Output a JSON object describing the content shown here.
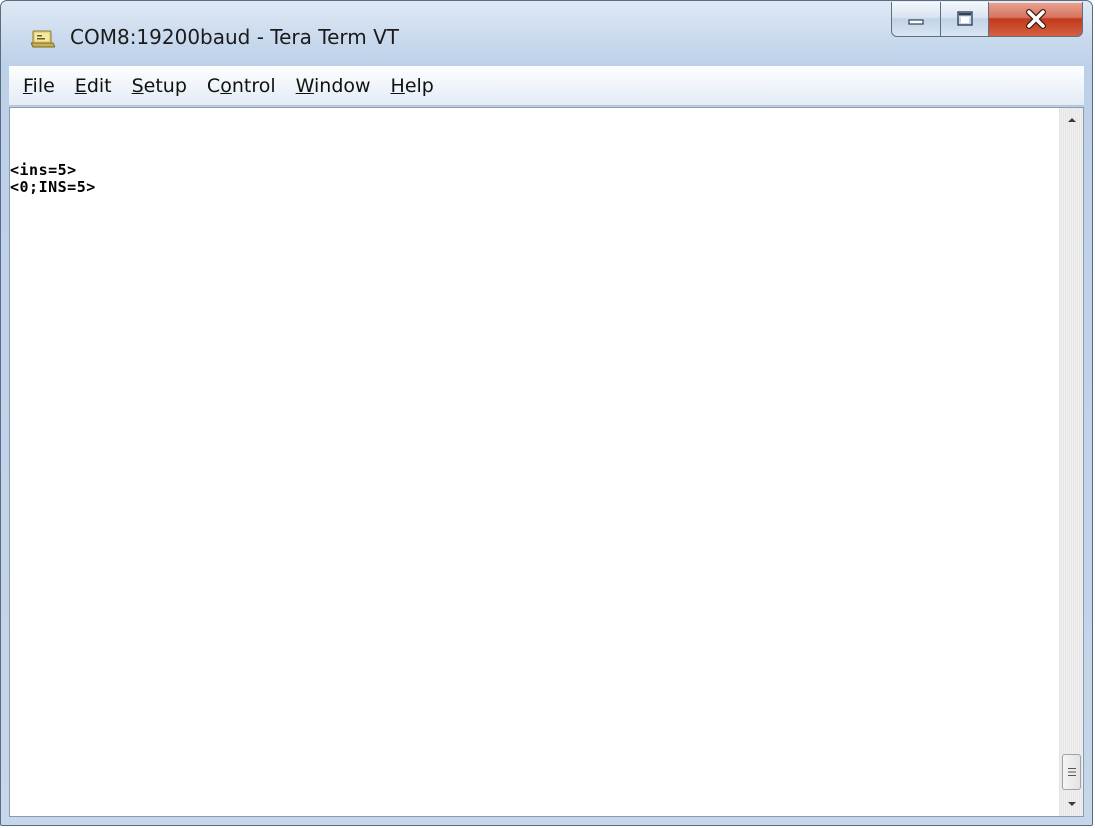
{
  "window": {
    "title": "COM8:19200baud - Tera Term VT"
  },
  "menu": {
    "items": [
      {
        "label": "File",
        "mnemonic": "F",
        "rest": "ile"
      },
      {
        "label": "Edit",
        "mnemonic": "E",
        "rest": "dit"
      },
      {
        "label": "Setup",
        "mnemonic": "S",
        "rest": "etup"
      },
      {
        "label": "Control",
        "prefix": "C",
        "mnemonic": "o",
        "rest": "ntrol"
      },
      {
        "label": "Window",
        "mnemonic": "W",
        "rest": "indow"
      },
      {
        "label": "Help",
        "mnemonic": "H",
        "rest": "elp"
      }
    ]
  },
  "terminal": {
    "lines": [
      "<ins=5>",
      "<0;INS=5>"
    ]
  },
  "icons": {
    "app": "tera-term-icon",
    "minimize": "minimize-icon",
    "maximize": "maximize-icon",
    "close": "close-icon",
    "scroll_up": "scroll-up-arrow-icon",
    "scroll_down": "scroll-down-arrow-icon",
    "scroll_grip": "scroll-grip-icon"
  },
  "colors": {
    "close_button": "#c7432a",
    "terminal_background": "#ffffff",
    "terminal_text": "#000000"
  }
}
